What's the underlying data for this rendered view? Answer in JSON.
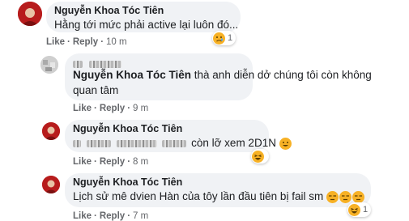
{
  "comments": [
    {
      "author": "Nguyễn Khoa Tóc Tiên",
      "text": "Hằng tới mức phải active lại luôn đó...",
      "like": "Like",
      "reply": "Reply",
      "time": "10 m",
      "reaction_count": "1",
      "reaction_icon": "sad-reaction-icon"
    },
    {
      "author": "Nguyễn Khoa Tóc Tiên",
      "text_line1": "thà anh diễn dở chúng tôi còn không",
      "text_line2": "quan tâm",
      "like": "Like",
      "reply": "Reply",
      "time": "9 m"
    },
    {
      "author": "Nguyễn Khoa Tóc Tiên",
      "text": "còn lỡ xem 2D1N",
      "like": "Like",
      "reply": "Reply",
      "time": "8 m",
      "reaction_icon": "haha-reaction-icon"
    },
    {
      "author": "Nguyễn Khoa Tóc Tiên",
      "text": "Lịch sử mê dvien Hàn của tôy lần đầu tiên bị fail sm",
      "like": "Like",
      "reply": "Reply",
      "time": "7 m",
      "reaction_count": "1",
      "reaction_icon": "haha-reaction-icon"
    }
  ],
  "colors": {
    "bubble": "#f0f2f5",
    "meta": "#65676b",
    "avatar": "#c61f1f",
    "emoji": "#f7b125"
  }
}
